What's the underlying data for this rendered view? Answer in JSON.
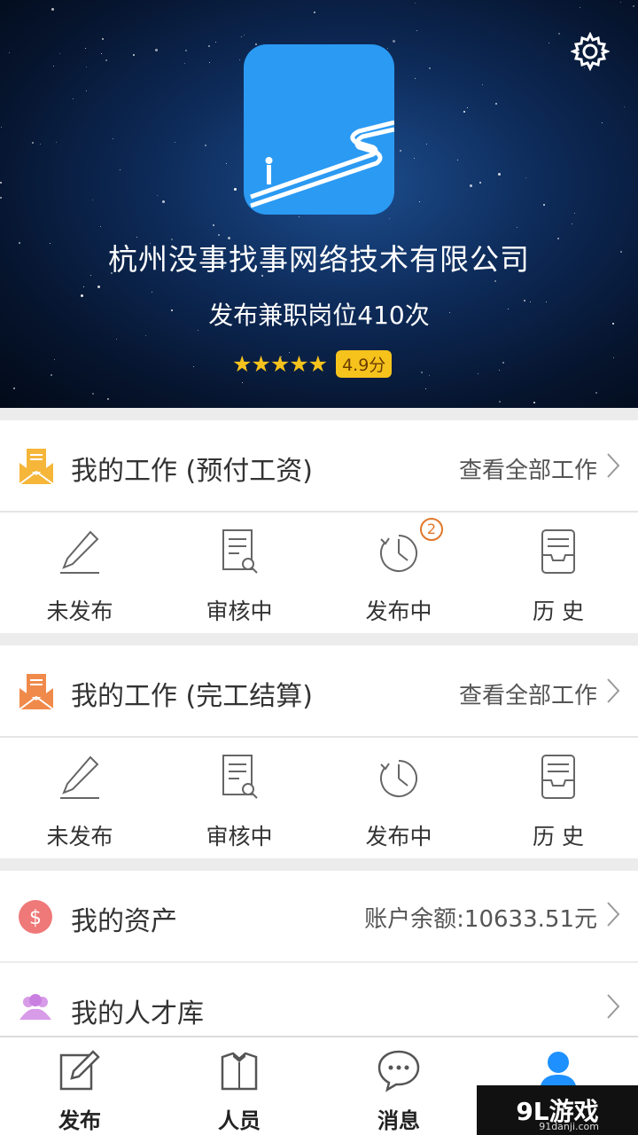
{
  "header": {
    "company_name": "杭州没事找事网络技术有限公司",
    "posted_text": "发布兼职岗位410次",
    "stars": "★★★★★",
    "score": "4.9分",
    "settings_icon": "gear-icon"
  },
  "prepaid_section": {
    "title": "我的工作 (预付工资)",
    "view_all": "查看全部工作",
    "icon": "envelope-icon",
    "icon_color": "#f5b63a",
    "items": [
      {
        "label": "未发布",
        "icon": "pencil-icon"
      },
      {
        "label": "审核中",
        "icon": "document-search-icon"
      },
      {
        "label": "发布中",
        "icon": "clock-icon",
        "badge": "2"
      },
      {
        "label": "历 史",
        "icon": "archive-icon"
      }
    ]
  },
  "settle_section": {
    "title": "我的工作 (完工结算)",
    "view_all": "查看全部工作",
    "icon": "envelope-icon",
    "icon_color": "#f08a4b",
    "items": [
      {
        "label": "未发布",
        "icon": "pencil-icon"
      },
      {
        "label": "审核中",
        "icon": "document-search-icon"
      },
      {
        "label": "发布中",
        "icon": "clock-icon"
      },
      {
        "label": "历 史",
        "icon": "archive-icon"
      }
    ]
  },
  "assets": {
    "title": "我的资产",
    "balance": "账户余额:10633.51元",
    "icon": "dollar-icon",
    "icon_color": "#ef7878"
  },
  "talent": {
    "title": "我的人才库",
    "icon": "people-icon",
    "icon_color": "#d79be8"
  },
  "tabbar": {
    "tabs": [
      {
        "label": "发布",
        "icon": "edit-icon"
      },
      {
        "label": "人员",
        "icon": "staff-icon"
      },
      {
        "label": "消息",
        "icon": "chat-icon"
      },
      {
        "label": "",
        "icon": "user-icon",
        "active": true
      }
    ],
    "accent": "#1e90ff"
  },
  "watermark": {
    "text": "9L游戏",
    "sub": "91danji.com"
  }
}
